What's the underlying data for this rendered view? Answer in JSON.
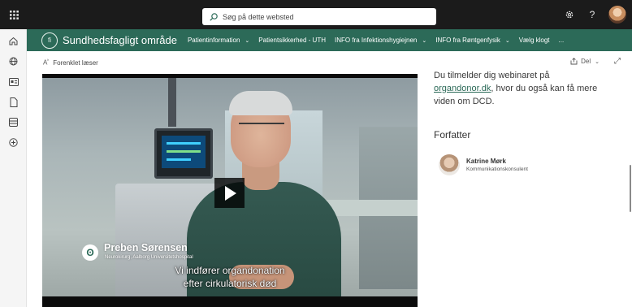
{
  "search": {
    "placeholder": "Søg på dette websted"
  },
  "site": {
    "logo_text": "fi",
    "title": "Sundhedsfagligt område",
    "nav": [
      {
        "label": "Patientinformation",
        "dropdown": true
      },
      {
        "label": "Patientsikkerhed - UTH",
        "dropdown": false
      },
      {
        "label": "INFO fra Infektionshygiejnen",
        "dropdown": true
      },
      {
        "label": "INFO fra Røntgenfysik",
        "dropdown": true
      },
      {
        "label": "Vælg klogt",
        "dropdown": false
      },
      {
        "label": "...",
        "dropdown": false
      }
    ]
  },
  "commandbar": {
    "reader_label": "Forenklet læser",
    "share_label": "Del"
  },
  "video": {
    "speaker_name": "Preben Sørensen",
    "speaker_role": "Neurokirurg, Aalborg Universitetshospital",
    "caption_line1": "Vi indfører organdonation",
    "caption_line2": "efter cirkulatorisk død"
  },
  "article": {
    "text_before": "Du tilmelder dig webinaret på",
    "link": "organdonor.dk",
    "text_after": ", hvor du også kan få mere viden om DCD."
  },
  "author": {
    "heading": "Forfatter",
    "name": "Katrine Mørk",
    "title": "Kommunikationskonsulent"
  },
  "colors": {
    "topbar": "#1b1b1b",
    "site_bar": "#2c6a58",
    "link": "#2c6a58"
  },
  "icons": {
    "rail": [
      "home-icon",
      "globe-icon",
      "news-icon",
      "document-icon",
      "list-icon",
      "add-icon"
    ]
  }
}
